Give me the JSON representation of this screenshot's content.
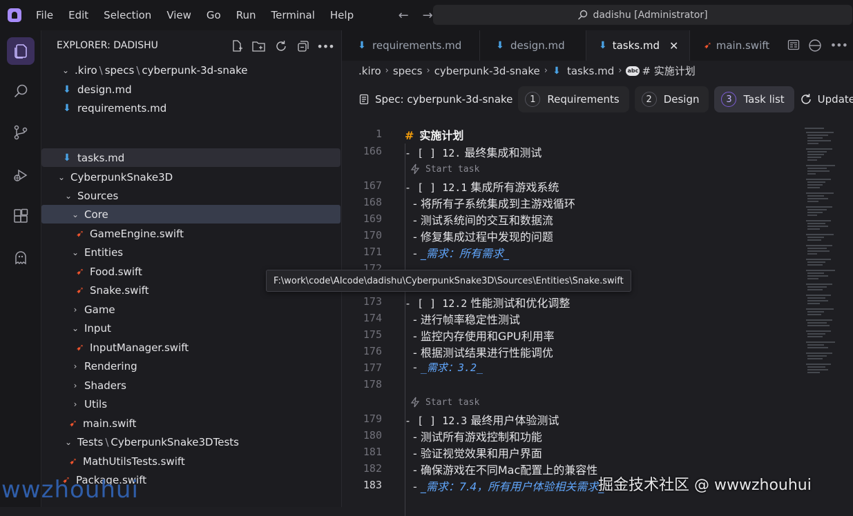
{
  "menu": [
    "File",
    "Edit",
    "Selection",
    "View",
    "Go",
    "Run",
    "Terminal",
    "Help"
  ],
  "search": {
    "text": "dadishu [Administrator]"
  },
  "sidebar": {
    "title": "EXPLORER: DADISHU",
    "tree": [
      {
        "kind": "path",
        "parts": [
          ".kiro",
          "specs",
          "cyberpunk-3d-snake"
        ]
      },
      {
        "kind": "md",
        "label": "design.md"
      },
      {
        "kind": "md",
        "label": "requirements.md"
      },
      {
        "kind": "md",
        "label": "tasks.md"
      },
      {
        "kind": "folder",
        "label": "CyberpunkSnake3D"
      },
      {
        "kind": "folder",
        "label": "Sources"
      },
      {
        "kind": "folder",
        "label": "Core"
      },
      {
        "kind": "swift",
        "label": "GameEngine.swift"
      },
      {
        "kind": "folder",
        "label": "Entities"
      },
      {
        "kind": "swift",
        "label": "Food.swift"
      },
      {
        "kind": "swift",
        "label": "Snake.swift"
      },
      {
        "kind": "folder",
        "label": "Game"
      },
      {
        "kind": "folder",
        "label": "Input"
      },
      {
        "kind": "swift",
        "label": "InputManager.swift"
      },
      {
        "kind": "folder",
        "label": "Rendering"
      },
      {
        "kind": "folder",
        "label": "Shaders"
      },
      {
        "kind": "folder",
        "label": "Utils"
      },
      {
        "kind": "swift",
        "label": "main.swift"
      },
      {
        "kind": "path",
        "parts": [
          "Tests",
          "CyberpunkSnake3DTests"
        ]
      },
      {
        "kind": "swift",
        "label": "MathUtilsTests.swift"
      },
      {
        "kind": "swift",
        "label": "Package.swift"
      }
    ]
  },
  "tabs": [
    {
      "label": "requirements.md",
      "kind": "md"
    },
    {
      "label": "design.md",
      "kind": "md"
    },
    {
      "label": "tasks.md",
      "kind": "md",
      "active": true
    },
    {
      "label": "main.swift",
      "kind": "swift"
    }
  ],
  "breadcrumbs": [
    ".kiro",
    "specs",
    "cyberpunk-3d-snake",
    "tasks.md",
    "# 实施计划"
  ],
  "spec": {
    "label": "Spec: cyberpunk-3d-snake",
    "steps": [
      {
        "num": "1",
        "label": "Requirements"
      },
      {
        "num": "2",
        "label": "Design"
      },
      {
        "num": "3",
        "label": "Task list",
        "active": true
      }
    ],
    "update": "Update tasks"
  },
  "code": {
    "start_task": "Start task",
    "lines": [
      {
        "n": "1",
        "text": "实施计划",
        "type": "header"
      },
      {
        "n": "166",
        "box": "- [ ] ",
        "num": "12.",
        "text": " 最终集成和测试"
      },
      {
        "n": "167",
        "box": "- [ ] ",
        "num": "12.1",
        "text": " 集成所有游戏系统"
      },
      {
        "n": "168",
        "text": "- 将所有子系统集成到主游戏循环"
      },
      {
        "n": "169",
        "text": "- 测试系统间的交互和数据流"
      },
      {
        "n": "170",
        "text": "- 修复集成过程中发现的问题"
      },
      {
        "n": "171",
        "text": "_需求：所有需求_",
        "type": "ital"
      },
      {
        "n": "172",
        "text": ""
      },
      {
        "n": "173",
        "box": "- [ ] ",
        "num": "12.2",
        "text": " 性能测试和优化调整"
      },
      {
        "n": "174",
        "text": "- 进行帧率稳定性测试"
      },
      {
        "n": "175",
        "text": "- 监控内存使用和GPU利用率"
      },
      {
        "n": "176",
        "text": "- 根据测试结果进行性能调优"
      },
      {
        "n": "177",
        "text": "_需求：3.2_",
        "type": "ital"
      },
      {
        "n": "178",
        "text": ""
      },
      {
        "n": "179",
        "box": "- [ ] ",
        "num": "12.3",
        "text": " 最终用户体验测试"
      },
      {
        "n": "180",
        "text": "- 测试所有游戏控制和功能"
      },
      {
        "n": "181",
        "text": "- 验证视觉效果和用户界面"
      },
      {
        "n": "182",
        "text": "- 确保游戏在不同Mac配置上的兼容性"
      },
      {
        "n": "183",
        "text": "_需求：7.4，所有用户体验相关需求_",
        "type": "ital"
      }
    ]
  },
  "tooltip": "F:\\work\\code\\AIcode\\dadishu\\CyberpunkSnake3D\\Sources\\Entities\\Snake.swift",
  "watermark": {
    "left": "wwzhouhui",
    "right": "掘金技术社区 @ wwwzhouhui"
  },
  "colors": {
    "accent": "#a78bfa",
    "md_icon": "#4aa3e6",
    "swift_icon": "#f0542d",
    "italic_text": "#60a5fa"
  }
}
